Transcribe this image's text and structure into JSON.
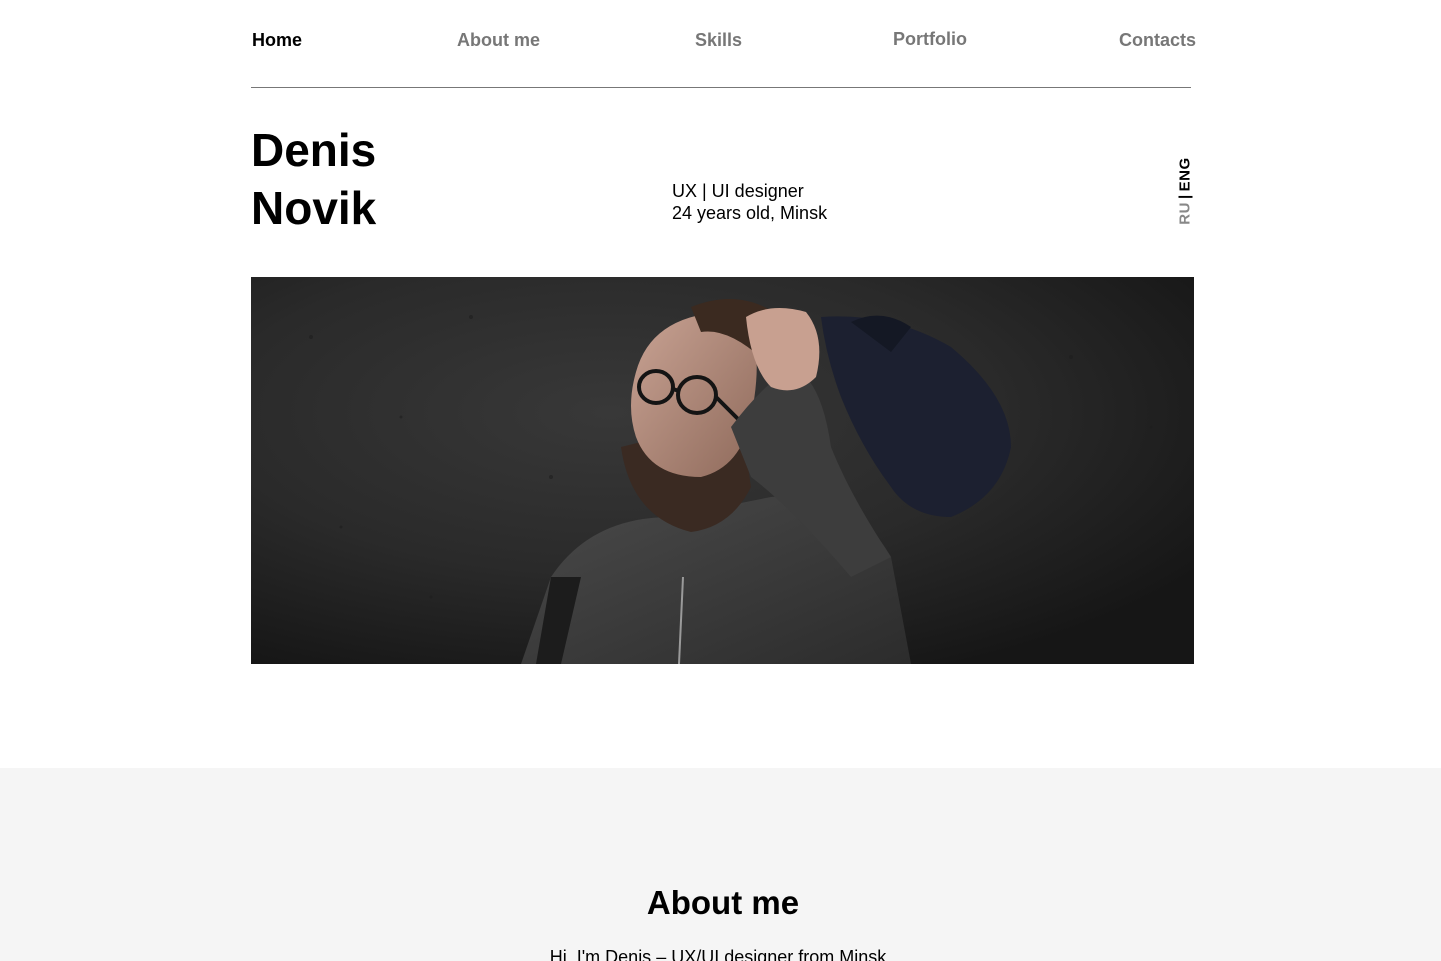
{
  "nav": {
    "items": [
      {
        "label": "Home",
        "active": true
      },
      {
        "label": "About me",
        "active": false
      },
      {
        "label": "Skills",
        "active": false
      },
      {
        "label": "Portfolio",
        "active": false
      },
      {
        "label": "Contacts",
        "active": false
      }
    ]
  },
  "hero": {
    "first_name": "Denis",
    "last_name": "Novik",
    "role": "UX | UI designer",
    "age_location": "24 years old, Minsk"
  },
  "language_switch": {
    "ru": "RU",
    "separator": "|",
    "eng": "ENG",
    "active": "ENG"
  },
  "about": {
    "title": "About me",
    "intro": "Hi, I'm Denis – UX/UI designer from Minsk"
  },
  "colors": {
    "background": "#ffffff",
    "about_background": "#f5f5f5",
    "text": "#000000",
    "muted_text": "#777777",
    "photo_background": "#2b2b2b"
  }
}
